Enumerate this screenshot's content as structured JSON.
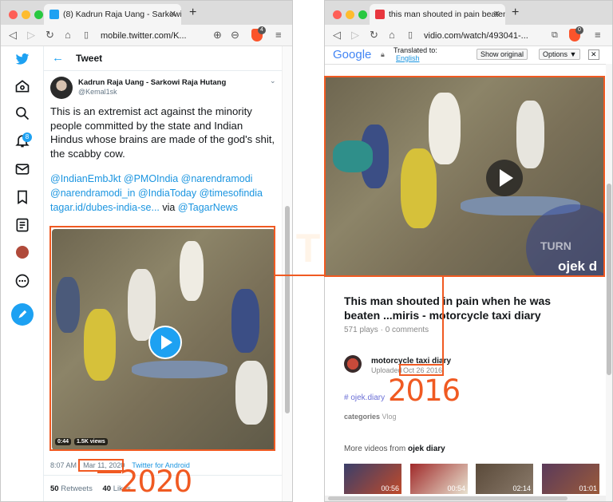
{
  "left_window": {
    "tab_title": "(8) Kadrun Raja Uang - Sarkowi R",
    "url": "mobile.twitter.com/K...",
    "brave_count": "4",
    "header_title": "Tweet",
    "author_name": "Kadrun Raja Uang - Sarkowi Raja Hutang",
    "author_handle": "@Kemal1sk",
    "tweet_text": "This is an extremist act against the minority people committed by the state and Indian Hindus whose brains are made of the god's shit, the scabby cow.",
    "mentions_line1": "@IndianEmbJkt @PMOIndia @narendramodi",
    "mentions_line2": "@narendramodi_in @IndiaToday @timesofindia",
    "link_text": "tagar.id/dubes-india-se...",
    "via_text": "via",
    "via_handle": "@TagarNews",
    "video_duration": "0:44",
    "video_views": "1.5K views",
    "time": "8:07 AM",
    "date": "Mar 11, 2020",
    "client": "Twitter for Android",
    "retweets_count": "50",
    "retweets_label": "Retweets",
    "likes_count": "40",
    "likes_label": "Likes",
    "notification_badge": "8",
    "year_annotation": "2020"
  },
  "right_window": {
    "tab_title": "this man shouted in pain beaten",
    "url": "vidio.com/watch/493041-...",
    "brave_count": "0",
    "google_logo": "Google",
    "translated_to": "Translated to:",
    "language": "English",
    "show_original": "Show original",
    "options": "Options ▼",
    "close": "✕",
    "video_watermark": "ojek d",
    "seal_text": "TURN",
    "video_title": "This man shouted in pain when he was beaten ...miris - motorcycle taxi diary",
    "plays": "571 plays",
    "comments": "0  comments",
    "channel_name": "motorcycle taxi diary",
    "uploaded_label": "Uploaded",
    "uploaded_date": "Oct 26 2016",
    "hashtag": "# ojek.diary",
    "categories_label": "categories",
    "category_value": "Vlog",
    "more_videos_prefix": "More videos from",
    "more_videos_channel": "ojek diary",
    "thumb_durations": [
      "00:56",
      "00:54",
      "02:14",
      "01:01"
    ],
    "year_annotation": "2016"
  },
  "background_watermark": "SCREENSHOTS",
  "colors": {
    "annotation": "#f05a22",
    "twitter_blue": "#1da1f2",
    "link": "#1b95e0"
  },
  "icons": [
    "twitter-bird-icon",
    "home-icon",
    "search-icon",
    "bell-icon",
    "mail-icon",
    "bookmark-icon",
    "list-icon",
    "more-icon",
    "compose-icon",
    "back-arrow-icon",
    "chevron-down-icon",
    "play-icon"
  ]
}
